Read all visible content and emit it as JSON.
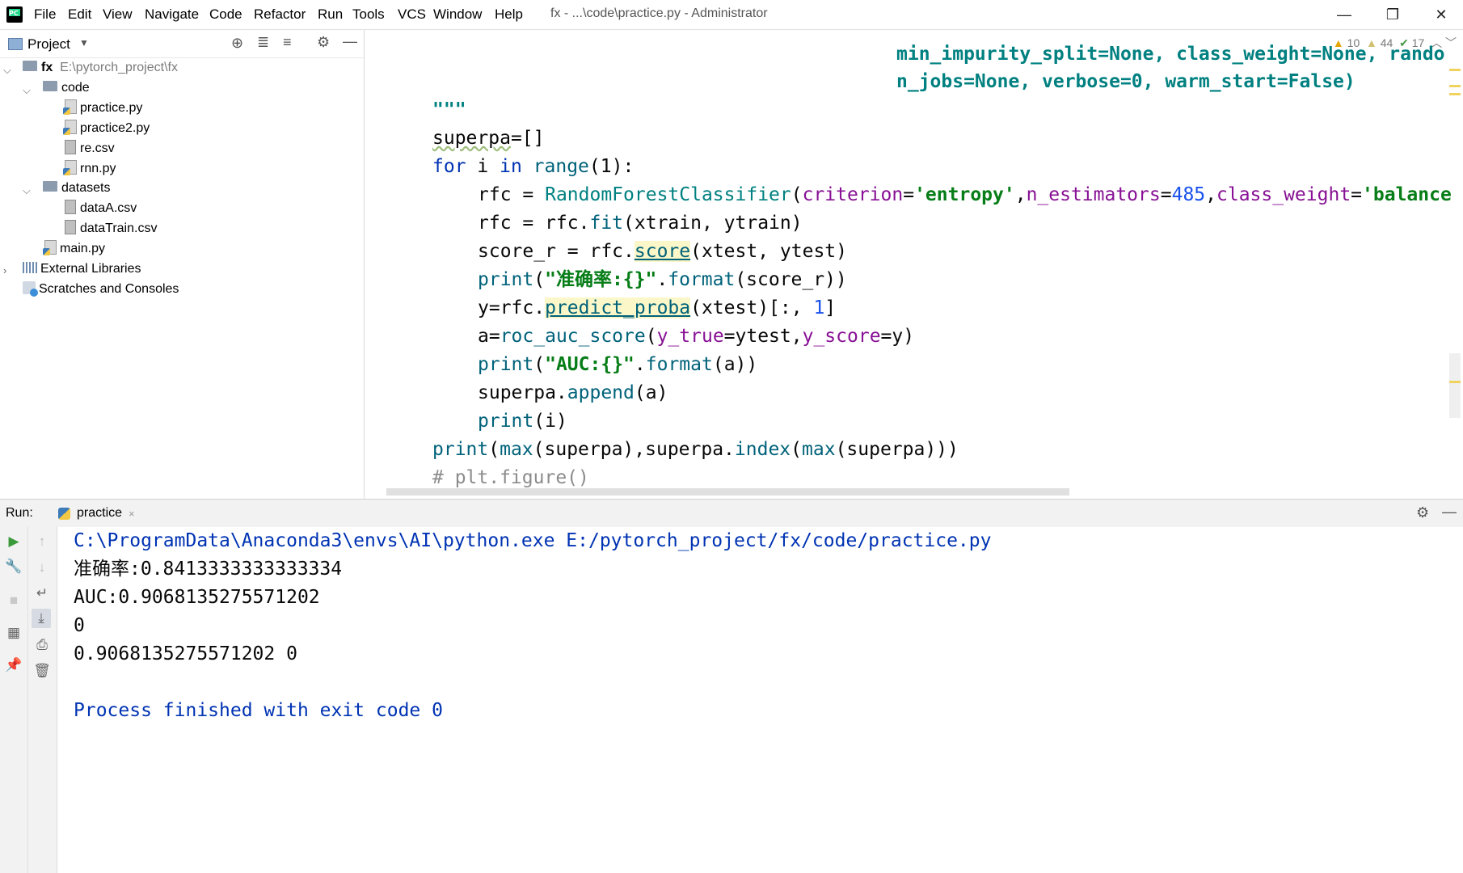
{
  "app": {
    "window_title": "fx - ...\\code\\practice.py - Administrator",
    "menu": [
      "File",
      "Edit",
      "View",
      "Navigate",
      "Code",
      "Refactor",
      "Run",
      "Tools",
      "VCS",
      "Window",
      "Help"
    ],
    "window_controls": {
      "minimize": "—",
      "restore": "❐",
      "close": "✕"
    }
  },
  "project": {
    "header_label": "Project",
    "tree": {
      "root_name": "fx",
      "root_path": "E:\\pytorch_project\\fx",
      "code_folder": "code",
      "code_files": [
        "practice.py",
        "practice2.py",
        "re.csv",
        "rnn.py"
      ],
      "datasets_folder": "datasets",
      "datasets_files": [
        "dataA.csv",
        "dataTrain.csv"
      ],
      "main_file": "main.py",
      "external_libraries": "External Libraries",
      "scratches": "Scratches and Consoles"
    }
  },
  "editor": {
    "inspections": {
      "warnings": "10",
      "weak_warnings": "44",
      "ok": "17"
    },
    "lines": {
      "l0": "min_impurity_split=None, class_weight=None, rando",
      "l1": "n_jobs=None, verbose=0, warm_start=False)",
      "l2": "\"\"\"",
      "l3_name": "superpa",
      "l3_rest": "=[]",
      "l4_for": "for",
      "l4_mid": " i ",
      "l4_in": "in",
      "l4_range": "range",
      "l4_rest": "(1):",
      "l5_a": "rfc = ",
      "l5_cls": "RandomForestClassifier",
      "l5_b": "(",
      "l5_p1": "criterion",
      "l5_eq": "=",
      "l5_s1": "'entropy'",
      "l5_c1": ",",
      "l5_p2": "n_estimators",
      "l5_eq2": "=",
      "l5_n1": "485",
      "l5_c2": ",",
      "l5_p3": "class_weight",
      "l5_eq3": "=",
      "l5_s2": "'balance",
      "l6_a": "rfc = rfc.",
      "l6_fit": "fit",
      "l6_b": "(xtrain, ytrain)",
      "l7_a": "score_r = rfc.",
      "l7_score": "score",
      "l7_b": "(xtest, ytest)",
      "l8_print": "print",
      "l8_a": "(",
      "l8_s": "\"准确率:{}\"",
      "l8_dot": ".",
      "l8_fmt": "format",
      "l8_b": "(score_r))",
      "l9_a": "y=rfc.",
      "l9_fn": "predict_proba",
      "l9_b": "(xtest)[:, ",
      "l9_n": "1",
      "l9_c": "]",
      "l10_a": "a=",
      "l10_fn": "roc_auc_score",
      "l10_b": "(",
      "l10_p1": "y_true",
      "l10_c": "=ytest,",
      "l10_p2": "y_score",
      "l10_d": "=y)",
      "l11_print": "print",
      "l11_a": "(",
      "l11_s": "\"AUC:{}\"",
      "l11_dot": ".",
      "l11_fmt": "format",
      "l11_b": "(a))",
      "l12_a": "superpa.",
      "l12_fn": "append",
      "l12_b": "(a)",
      "l13_print": "print",
      "l13_b": "(i)",
      "l14_print": "print",
      "l14_a": "(",
      "l14_max": "max",
      "l14_b": "(superpa),superpa.",
      "l14_index": "index",
      "l14_c": "(",
      "l14_max2": "max",
      "l14_d": "(superpa)))",
      "l15": "# plt.figure()"
    }
  },
  "run": {
    "label": "Run:",
    "tab_name": "practice",
    "tab_close": "×",
    "output": [
      "C:\\ProgramData\\Anaconda3\\envs\\AI\\python.exe E:/pytorch_project/fx/code/practice.py",
      "准确率:0.8413333333333334",
      "AUC:0.9068135275571202",
      "0",
      "0.9068135275571202 0",
      "",
      "Process finished with exit code 0"
    ]
  },
  "colors": {
    "keyword": "#0033b3",
    "function": "#00627a",
    "string": "#067d17",
    "number": "#1750eb",
    "param": "#871094",
    "comment": "#8c8c8c",
    "selected_tab": "#4083c9"
  },
  "icons": [
    "pycharm-logo-icon",
    "project-icon",
    "locate-icon",
    "expand-all-icon",
    "collapse-all-icon",
    "gear-icon",
    "hide-icon",
    "run-icon",
    "wrench-icon",
    "stop-icon",
    "layout-icon",
    "pin-icon",
    "up-arrow-icon",
    "down-arrow-icon",
    "soft-wrap-icon",
    "scroll-to-end-icon",
    "print-icon",
    "trash-icon"
  ]
}
